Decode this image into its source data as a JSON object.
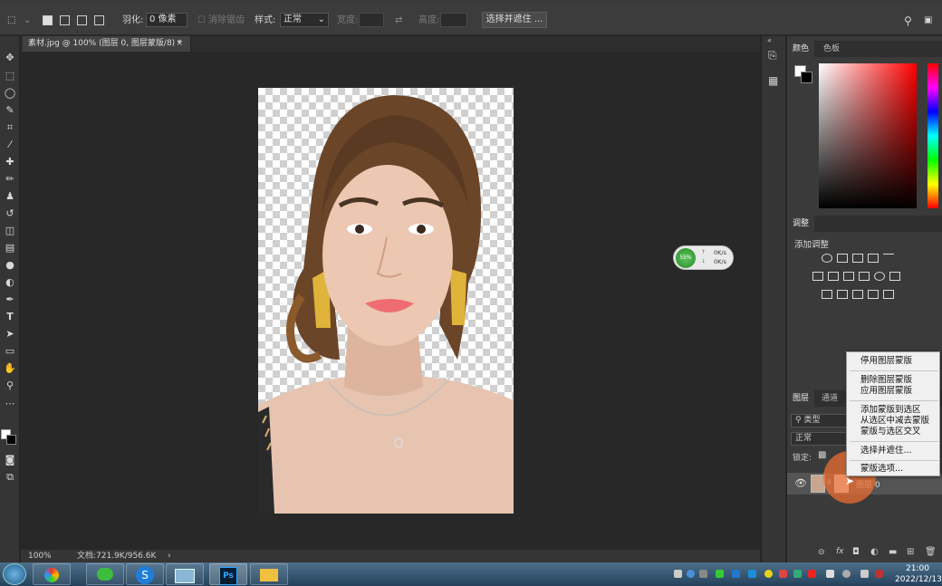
{
  "options_bar": {
    "feather_label": "羽化:",
    "feather_value": "0 像素",
    "antialias_label": "消除锯齿",
    "style_label": "样式:",
    "style_value": "正常",
    "width_label": "宽度:",
    "height_label": "高度:",
    "select_mask_button": "选择并遮住 ..."
  },
  "document": {
    "tab_title": "素材.jpg @ 100% (图层 0, 图层蒙版/8) *",
    "zoom": "100%",
    "doc_info": "文档:721.9K/956.6K"
  },
  "net_widget": {
    "percent": "55%",
    "up": "0K/s",
    "down": "0K/s"
  },
  "color_panel": {
    "tabs": [
      "颜色",
      "色板"
    ]
  },
  "adjust_panel": {
    "tab": "调整",
    "title": "添加调整"
  },
  "layers_panel": {
    "tabs": [
      "图层",
      "通道"
    ],
    "filter_value": "类型",
    "blend_mode": "正常",
    "lock_label": "锁定:",
    "layer_name": "图层 0"
  },
  "context_menu": {
    "items": [
      "停用图层蒙版",
      "删除图层蒙版",
      "应用图层蒙版",
      "添加蒙版到选区",
      "从选区中减去蒙版",
      "蒙版与选区交叉",
      "选择并遮住...",
      "蒙版选项..."
    ]
  },
  "clock": {
    "time": "21:00",
    "date": "2022/12/13"
  }
}
